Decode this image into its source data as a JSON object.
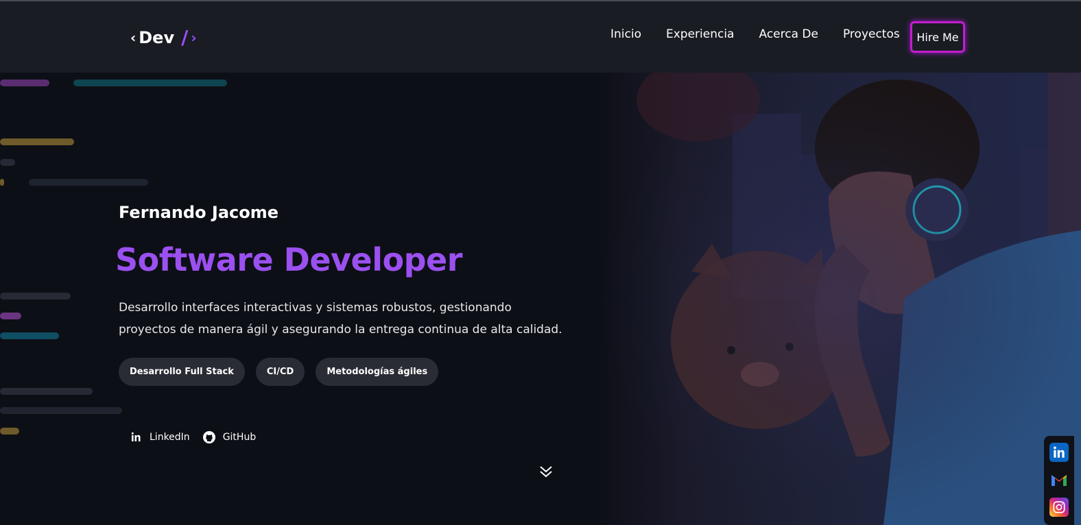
{
  "header": {
    "logo": {
      "lt": "‹",
      "text": "Dev",
      "slash": "/",
      "gt": "›"
    },
    "nav": [
      {
        "label": "Inicio"
      },
      {
        "label": "Experiencia"
      },
      {
        "label": "Acerca De"
      },
      {
        "label": "Proyectos"
      }
    ],
    "hire_label": "Hire Me"
  },
  "hero": {
    "name": "Fernando Jacome",
    "role": "Software Developer",
    "description": "Desarrollo interfaces interactivas y sistemas robustos, gestionando proyectos de manera ágil y asegurando la entrega continua de alta calidad.",
    "tags": [
      {
        "label": "Desarrollo Full Stack"
      },
      {
        "label": "CI/CD"
      },
      {
        "label": "Metodologías ágiles"
      }
    ],
    "socials": [
      {
        "label": "LinkedIn",
        "icon": "linkedin-icon"
      },
      {
        "label": "GitHub",
        "icon": "github-icon"
      }
    ]
  },
  "side_bar": {
    "icons": [
      "linkedin-icon",
      "gmail-icon",
      "instagram-icon"
    ]
  },
  "colors": {
    "accent": "#9b50f0",
    "hire_border": "#c21ecf",
    "background": "#0d0f16",
    "header_bg": "#1a1c24",
    "tag_bg": "#2a2c35"
  }
}
